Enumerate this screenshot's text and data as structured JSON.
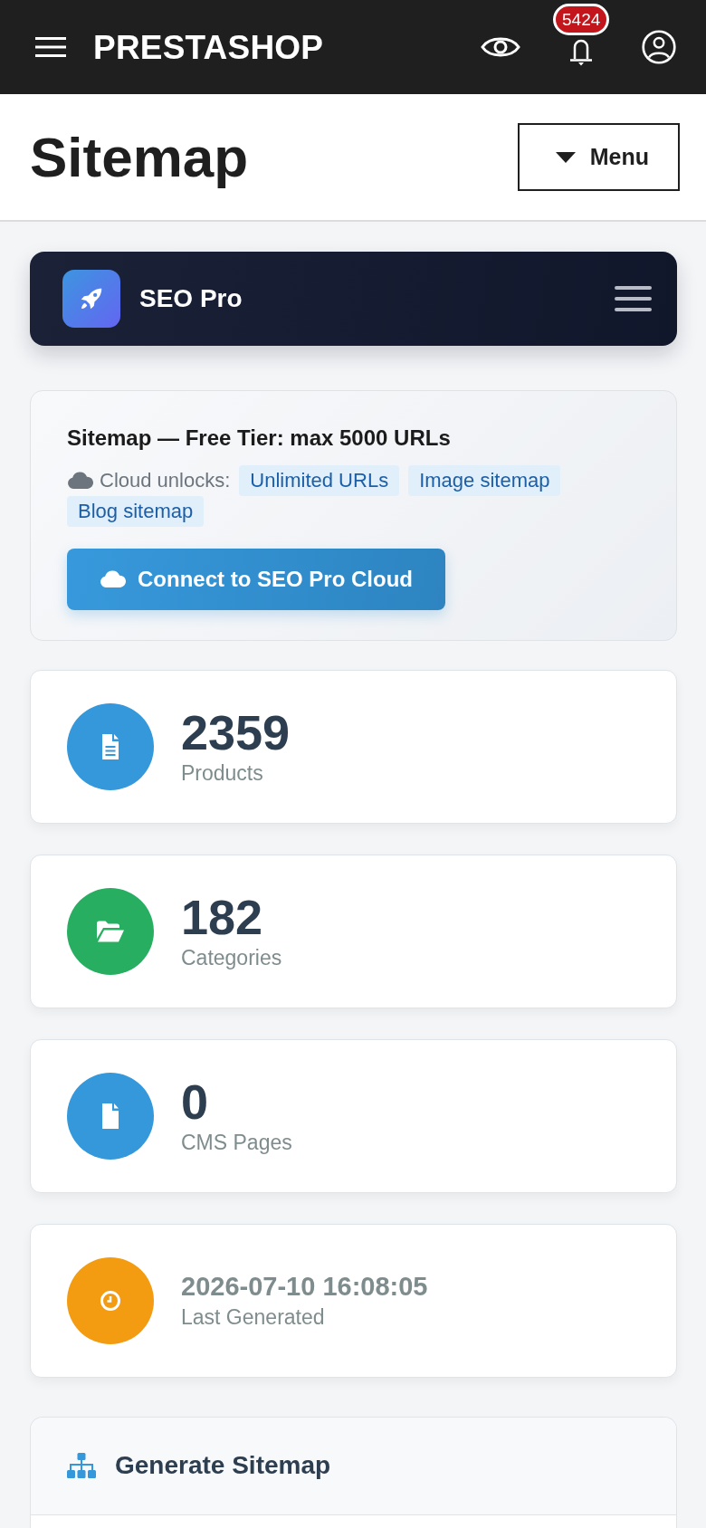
{
  "topbar": {
    "brand": "PRESTASHOP",
    "notification_count": "5424"
  },
  "page_header": {
    "title": "Sitemap",
    "menu_button": "Menu"
  },
  "module_bar": {
    "title": "SEO Pro"
  },
  "cloud_card": {
    "title": "Sitemap — Free Tier: max 5000 URLs",
    "unlocks_label": "Cloud unlocks:",
    "features": [
      "Unlimited URLs",
      "Image sitemap",
      "Blog sitemap"
    ],
    "button": "Connect to SEO Pro Cloud"
  },
  "stats": [
    {
      "kind": "products",
      "value": "2359",
      "label": "Products",
      "color": "#3498db"
    },
    {
      "kind": "categories",
      "value": "182",
      "label": "Categories",
      "color": "#27ae60"
    },
    {
      "kind": "pages",
      "value": "0",
      "label": "CMS Pages",
      "color": "#3498db"
    },
    {
      "kind": "timestamp",
      "value": "2026-07-10 16:08:05",
      "label": "Last Generated",
      "color": "#f39c12"
    }
  ],
  "generate_panel": {
    "title": "Generate Sitemap"
  }
}
